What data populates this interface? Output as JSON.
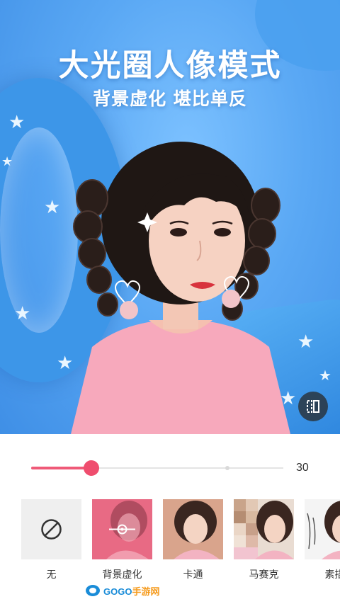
{
  "headline": {
    "title": "大光圈人像模式",
    "subtitle": "背景虚化  堪比单反"
  },
  "compare_button": {
    "icon": "compare-icon"
  },
  "slider": {
    "value": 30,
    "value_label": "30",
    "fill_fraction": 0.24,
    "accent_color": "#ef4d6e"
  },
  "effects": [
    {
      "label": "无",
      "icon": "none-icon"
    },
    {
      "label": "背景虚化",
      "icon": "blur-slider-icon",
      "selected": true
    },
    {
      "label": "卡通"
    },
    {
      "label": "马赛克"
    },
    {
      "label": "素描"
    }
  ],
  "watermark": {
    "text_part1": "GOGO",
    "text_part2": "手游网",
    "small": "GOGOO.CN"
  }
}
